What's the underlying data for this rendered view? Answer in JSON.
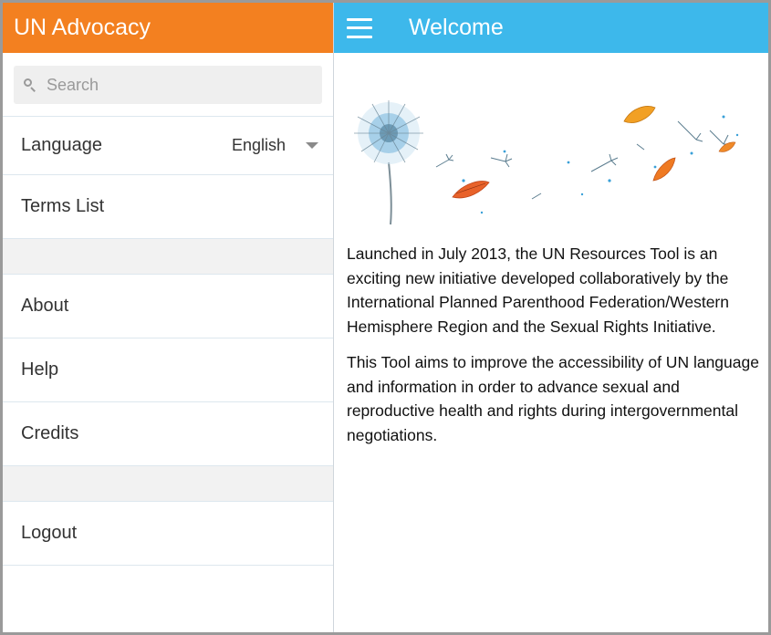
{
  "sidebar": {
    "title": "UN Advocacy",
    "search": {
      "placeholder": "Search",
      "value": ""
    },
    "language": {
      "label": "Language",
      "value": "English"
    },
    "items": [
      {
        "label": "Terms List"
      },
      {
        "label": "About"
      },
      {
        "label": "Help"
      },
      {
        "label": "Credits"
      },
      {
        "label": "Logout"
      }
    ]
  },
  "header": {
    "title": "Welcome",
    "menu_icon": "hamburger-icon"
  },
  "banner": {
    "image": "dandelion-leaves-illustration"
  },
  "content": {
    "paragraphs": [
      "Launched in July 2013, the UN Resources Tool is an exciting new initiative developed collaboratively by the International Planned Parenthood Federation/Western Hemisphere Region and the Sexual Rights Initiative.",
      "This Tool aims to improve the accessibility of UN language and information in order to advance sexual and reproductive health and rights during intergovernmental negotiations."
    ]
  },
  "colors": {
    "sidebar_header": "#f38020",
    "main_header": "#3db8eb",
    "divider": "#dde7ee"
  }
}
